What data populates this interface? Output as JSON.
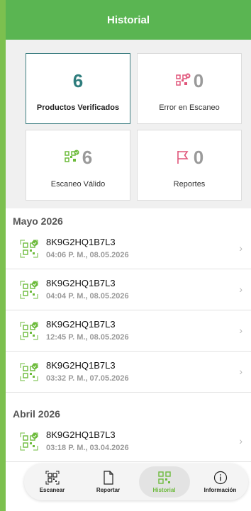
{
  "header": {
    "title": "Historial"
  },
  "stats": [
    {
      "value": "6",
      "label": "Productos Verificados",
      "icon": "none",
      "selected": true
    },
    {
      "value": "0",
      "label": "Error en Escaneo",
      "icon": "qr-error-icon"
    },
    {
      "value": "6",
      "label": "Escaneo Válido",
      "icon": "qr-check-icon"
    },
    {
      "value": "0",
      "label": "Reportes",
      "icon": "flag-icon"
    }
  ],
  "sections": [
    {
      "title": "Mayo 2026",
      "items": [
        {
          "code": "8K9G2HQ1B7L3",
          "time": "04:06 P. M., 08.05.2026"
        },
        {
          "code": "8K9G2HQ1B7L3",
          "time": "04:04 P. M., 08.05.2026"
        },
        {
          "code": "8K9G2HQ1B7L3",
          "time": "12:45 P. M., 08.05.2026"
        },
        {
          "code": "8K9G2HQ1B7L3",
          "time": "03:32 P. M., 07.05.2026"
        }
      ]
    },
    {
      "title": "Abril 2026",
      "items": [
        {
          "code": "8K9G2HQ1B7L3",
          "time": "03:18 P. M., 03.04.2026"
        }
      ]
    }
  ],
  "nav": [
    {
      "label": "Escanear",
      "icon": "qr-scan-icon"
    },
    {
      "label": "Reportar",
      "icon": "document-icon"
    },
    {
      "label": "Historial",
      "icon": "qr-history-icon",
      "active": true
    },
    {
      "label": "Información",
      "icon": "info-icon"
    }
  ],
  "colors": {
    "accent": "#5ab552",
    "selected_border": "#3f7f83",
    "error": "#e0557a"
  }
}
